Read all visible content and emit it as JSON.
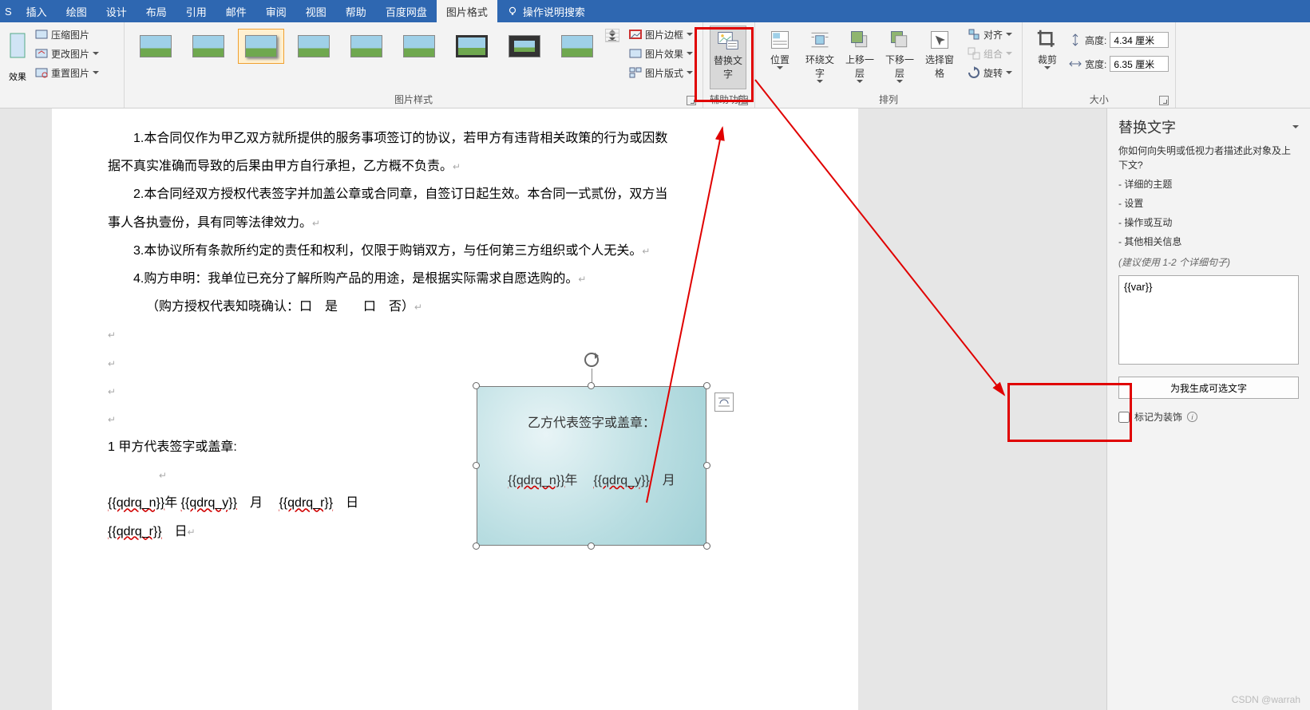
{
  "menu": {
    "tabs": [
      "插入",
      "绘图",
      "设计",
      "布局",
      "引用",
      "邮件",
      "审阅",
      "视图",
      "帮助",
      "百度网盘",
      "图片格式"
    ],
    "active_index": 10,
    "tellme": "操作说明搜索"
  },
  "ribbon": {
    "adjust": {
      "compress": "压缩图片",
      "change": "更改图片",
      "reset": "重置图片",
      "effects": "效果"
    },
    "styles_label": "图片样式",
    "border": "图片边框",
    "effect": "图片效果",
    "layout": "图片版式",
    "alt_text": "替换文字",
    "acc_label": "辅助功能",
    "position": "位置",
    "wrap": "环绕文字",
    "bring_fwd": "上移一层",
    "send_back": "下移一层",
    "selection": "选择窗格",
    "align": "对齐",
    "group": "组合",
    "rotate": "旋转",
    "arrange_label": "排列",
    "crop": "裁剪",
    "height_label": "高度:",
    "height_value": "4.34 厘米",
    "width_label": "宽度:",
    "width_value": "6.35 厘米",
    "size_label": "大小"
  },
  "doc": {
    "p1a": "1.本合同仅作为甲乙双方就所提供的服务事项签订的协议，若甲方有违背相关政策的行为或因数",
    "p1b": "据不真实准确而导致的后果由甲方自行承担，乙方概不负责。",
    "p2a": "2.本合同经双方授权代表签字并加盖公章或合同章，自签订日起生效。本合同一式贰份，双方当",
    "p2b": "事人各执壹份，具有同等法律效力。",
    "p3": "3.本协议所有条款所约定的责任和权利，仅限于购销双方，与任何第三方组织或个人无关。",
    "p4": "4.购方申明：我单位已充分了解所购产品的用途，是根据实际需求自愿选购的。",
    "p5": "（购方授权代表知晓确认：口　是　　口　否）",
    "sig_a": "1 甲方代表签字或盖章:",
    "sig_b": "乙方代表签字或盖章：",
    "date_a_n": "{{qdrq_n}}",
    "date_a_y": "{{qdrq_y}}",
    "date_a_r": "{{qdrq_r}}",
    "date_a_r2": "{{qdrq_r}}",
    "yr": "年",
    "mo": "月",
    "dy": "日",
    "date_b_n": "{{qdrq_n}}",
    "date_b_y": "{{qdrq_y}}"
  },
  "altpane": {
    "title": "替换文字",
    "q": "你如何向失明或低视力者描述此对象及上下文?",
    "b1": "- 详细的主题",
    "b2": "- 设置",
    "b3": "- 操作或互动",
    "b4": "- 其他相关信息",
    "hint": "(建议使用 1-2 个详细句子)",
    "value": "{{var}}",
    "gen": "为我生成可选文字",
    "deco": "标记为装饰"
  },
  "watermark": "CSDN @warrah"
}
